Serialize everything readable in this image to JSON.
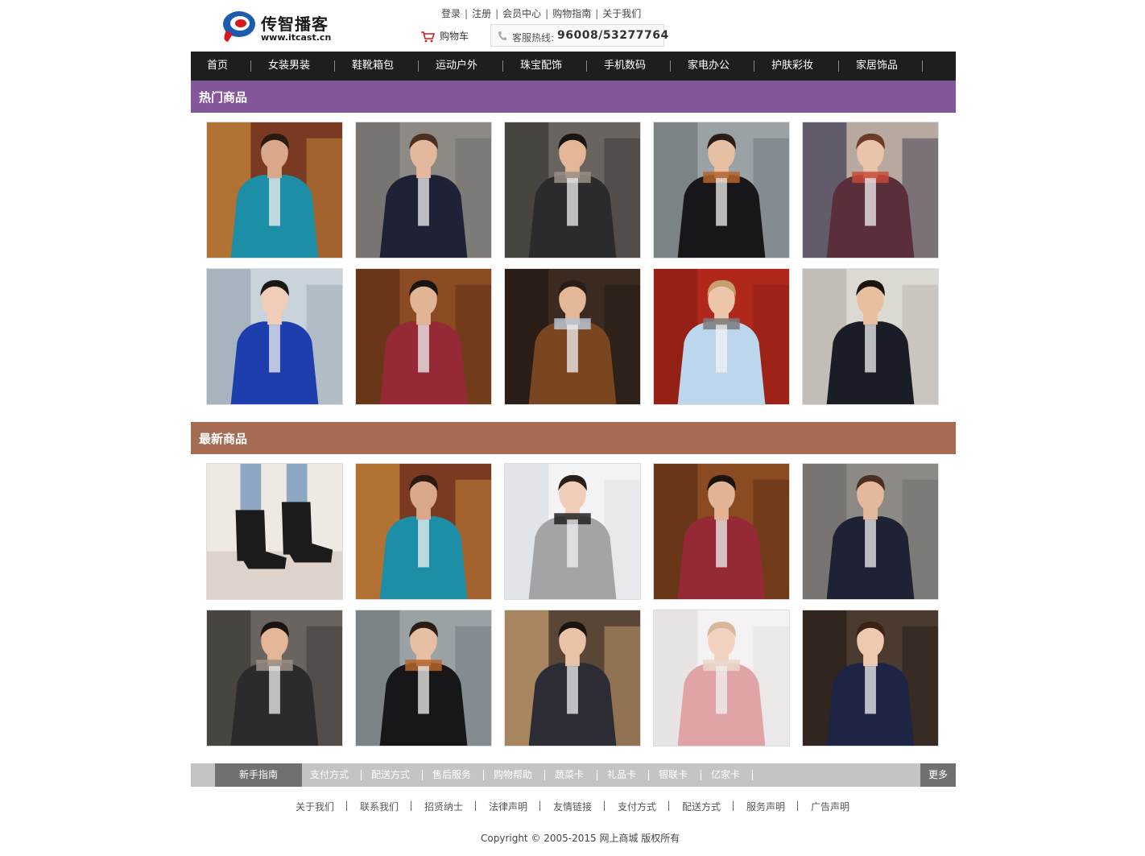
{
  "brand": {
    "name_cn": "传智播客",
    "url": "www.itcast.cn"
  },
  "top_links": [
    "登录",
    "注册",
    "会员中心",
    "购物指南",
    "关于我们"
  ],
  "cart": {
    "label": "购物车"
  },
  "hotline": {
    "label": "客服热线:",
    "number": "96008/53277764"
  },
  "nav": [
    "首页",
    "女装男装",
    "鞋靴箱包",
    "运动户外",
    "珠宝配饰",
    "手机数码",
    "家电办公",
    "护肤彩妆",
    "家居饰品"
  ],
  "sections": {
    "hot": {
      "title": "热门商品",
      "color": "#83579a"
    },
    "new": {
      "title": "最新商品",
      "color": "#a56b53"
    }
  },
  "products": {
    "hot": [
      "man-teal-jacket-icon",
      "man-navy-knit-jacket-icon",
      "man-scarf-skateboard-icon",
      "man-black-hoodie-icon",
      "woman-patterned-sweater-icon",
      "woman-blue-sweater-icon",
      "man-red-sweater-icon",
      "man-brown-jacket-icon",
      "man-light-blue-shirt-icon",
      "man-black-jacket-icon"
    ],
    "new": [
      "black-ankle-boots-icon",
      "man-teal-jacket-icon",
      "woman-grey-dress-icon",
      "man-red-sweater-icon",
      "man-navy-knit-jacket-icon",
      "man-scarf-skateboard-icon",
      "man-black-hoodie-icon",
      "woman-dark-coat-icon",
      "woman-pink-sweater-icon",
      "woman-navy-coat-icon"
    ]
  },
  "footer_bar": {
    "first": "新手指南",
    "items": [
      "支付方式",
      "配送方式",
      "售后服务",
      "购物帮助",
      "蔬菜卡",
      "礼品卡",
      "银联卡",
      "亿家卡"
    ],
    "more": "更多"
  },
  "footer_links": [
    "关于我们",
    "联系我们",
    "招贤纳士",
    "法律声明",
    "友情链接",
    "支付方式",
    "配送方式",
    "服务声明",
    "广告声明"
  ],
  "copyright": "Copyright © 2005-2015 网上商城 版权所有"
}
